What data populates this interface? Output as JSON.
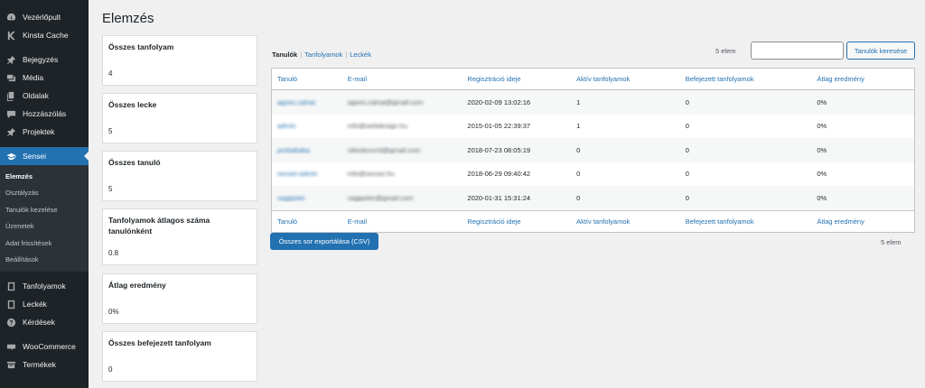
{
  "sidebar": {
    "items_top": [
      {
        "label": "Vezérlőpult",
        "icon": "dashboard-icon"
      },
      {
        "label": "Kinsta Cache",
        "icon": "kinsta-icon"
      }
    ],
    "items_mid": [
      {
        "label": "Bejegyzés",
        "icon": "pin-icon"
      },
      {
        "label": "Média",
        "icon": "media-icon"
      },
      {
        "label": "Oldalak",
        "icon": "pages-icon"
      },
      {
        "label": "Hozzászólás",
        "icon": "comment-icon"
      },
      {
        "label": "Projektek",
        "icon": "pin-icon"
      }
    ],
    "active": {
      "label": "Sensei",
      "icon": "graduation-cap-icon"
    },
    "submenu": [
      "Elemzés",
      "Osztályzás",
      "Tanulók kezelése",
      "Üzenetek",
      "Adat frissítések",
      "Beállítások"
    ],
    "items_bottom": [
      {
        "label": "Tanfolyamok",
        "icon": "book-icon"
      },
      {
        "label": "Leckék",
        "icon": "book-icon"
      },
      {
        "label": "Kérdések",
        "icon": "question-icon"
      }
    ],
    "items_bottom2": [
      {
        "label": "WooCommerce",
        "icon": "woocommerce-icon"
      },
      {
        "label": "Termékek",
        "icon": "archive-icon"
      }
    ]
  },
  "page": {
    "title": "Elemzés"
  },
  "stats": [
    {
      "title": "Összes tanfolyam",
      "value": "4"
    },
    {
      "title": "Összes lecke",
      "value": "5"
    },
    {
      "title": "Összes tanuló",
      "value": "5"
    },
    {
      "title": "Tanfolyamok átlagos száma tanulónként",
      "value": "0.8"
    },
    {
      "title": "Átlag eredmény",
      "value": "0%"
    },
    {
      "title": "Összes befejezett tanfolyam",
      "value": "0"
    }
  ],
  "tabs": {
    "t1": "Tanulók",
    "t2": "Tanfolyamok",
    "t3": "Leckék",
    "sep": "|"
  },
  "count": "5 elem",
  "search": {
    "button": "Tanulók keresése",
    "placeholder": ""
  },
  "table": {
    "columns": [
      "Tanuló",
      "E-mail",
      "Regisztráció ideje",
      "Aktív tanfolyamok",
      "Befejezett tanfolyamok",
      "Átlag eredmény"
    ],
    "rows": [
      [
        "agnes.zalnai",
        "agnes.zalnai@gmail.com",
        "2020-02-09 13:02:16",
        "1",
        "0",
        "0%"
      ],
      [
        "admin",
        "info@webdesign.hu",
        "2015-01-05 22:39:37",
        "1",
        "0",
        "0%"
      ],
      [
        "probababa",
        "sikeskurvnii@gmail.com",
        "2018-07-23 08:05:19",
        "0",
        "0",
        "0%"
      ],
      [
        "sensei-admin",
        "info@sensei.hu",
        "2018-06-29 09:40:42",
        "0",
        "0",
        "0%"
      ],
      [
        "vagipeter",
        "vagipeter@gmail.com",
        "2020-01-31 15:31:24",
        "0",
        "0",
        "0%"
      ]
    ]
  },
  "export": {
    "label": "Összes sor exportálása (CSV)"
  }
}
